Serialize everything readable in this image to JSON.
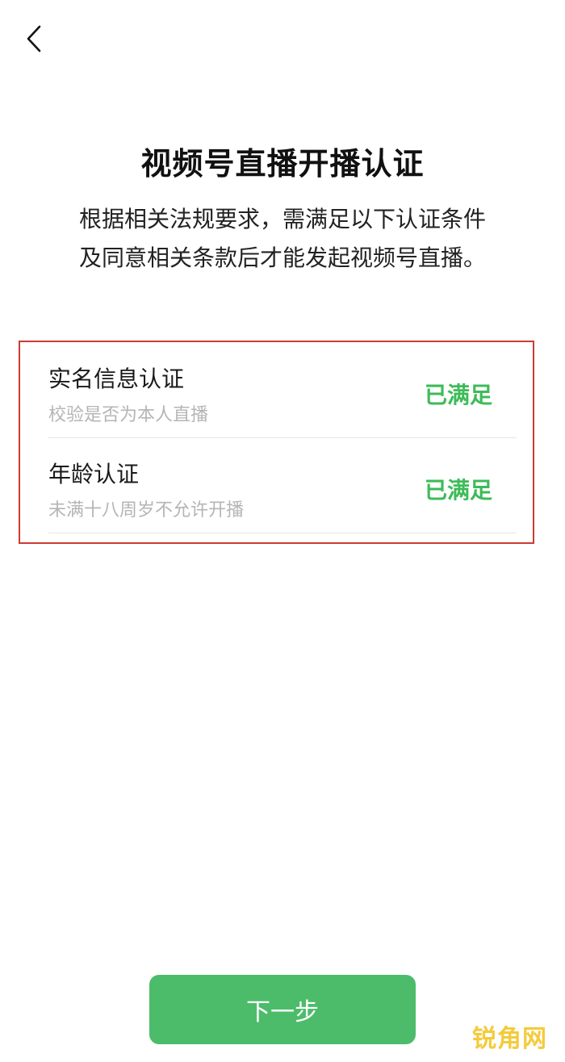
{
  "header": {
    "back_icon": "chevron-left-icon"
  },
  "page": {
    "title": "视频号直播开播认证",
    "description_lines": [
      "根据相关法规要求，需满足以下认证条件",
      "及同意相关条款后才能发起视频号直播。"
    ]
  },
  "requirements": [
    {
      "title": "实名信息认证",
      "subtitle": "校验是否为本人直播",
      "status": "已满足"
    },
    {
      "title": "年龄认证",
      "subtitle": "未满十八周岁不允许开播",
      "status": "已满足"
    }
  ],
  "footer": {
    "next_label": "下一步"
  },
  "watermark": {
    "text": "锐角网"
  },
  "colors": {
    "accent_green": "#3dbb58",
    "button_green": "#4cbc6a",
    "highlight_border": "#cc3b34",
    "watermark": "#f3c21a"
  }
}
